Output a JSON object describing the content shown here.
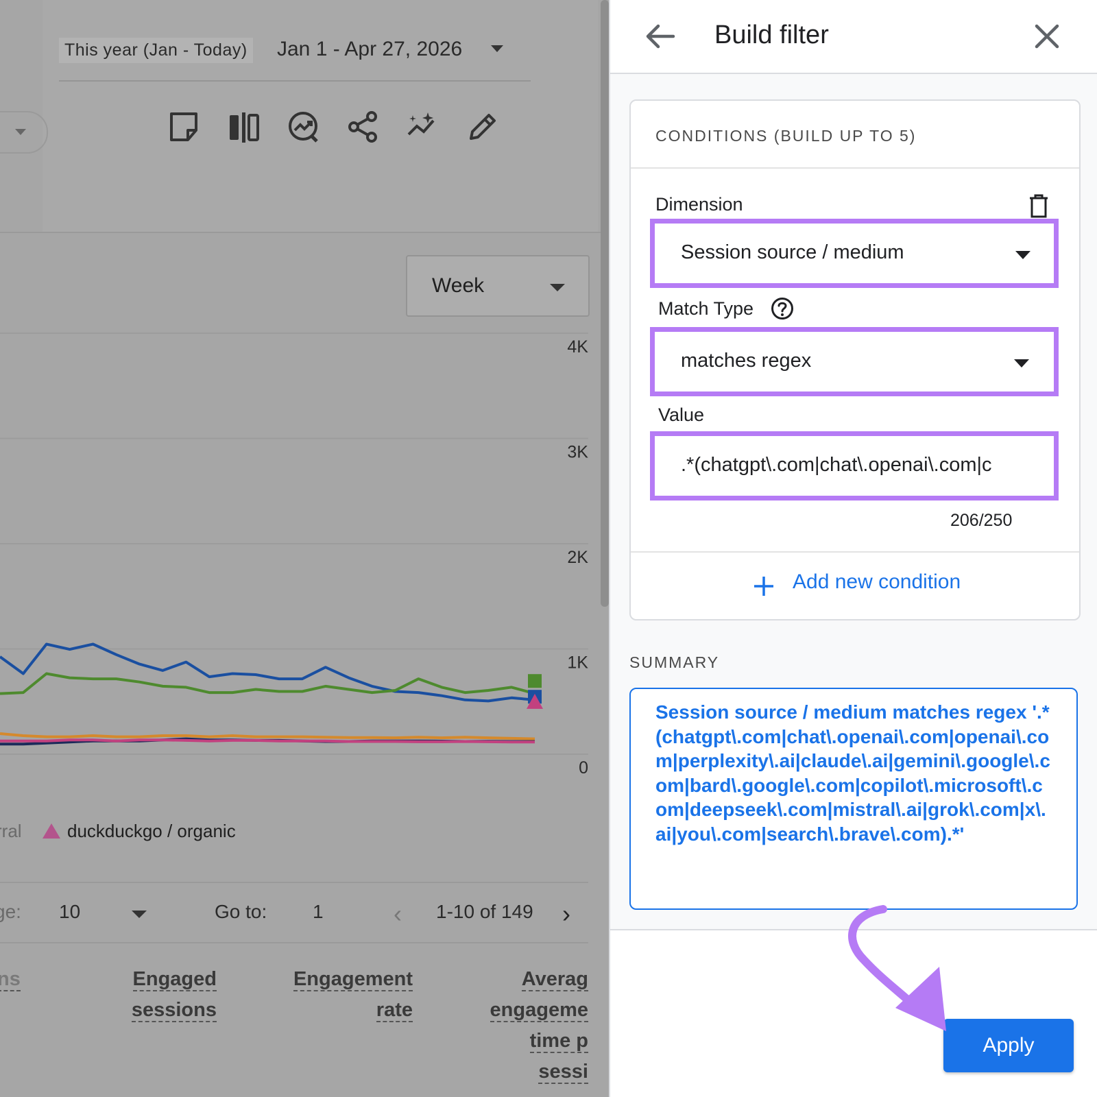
{
  "report": {
    "date_preset": "This year (Jan - Today)",
    "date_range": "Jan 1 - Apr 27, 2026",
    "granularity": "Week",
    "toolbar_icons": [
      "note-icon",
      "compare-icon",
      "insights-icon",
      "share-icon",
      "sparkle-icon",
      "edit-icon"
    ],
    "legend": {
      "fragment": "rral",
      "item": "duckduckgo / organic",
      "item_color": "#b3548c"
    },
    "pagination": {
      "rows_fragment": "ge:",
      "rows_per_page": "10",
      "goto_label": "Go to:",
      "goto_value": "1",
      "range": "1-10 of 149"
    },
    "columns": [
      {
        "lines": [
          "ns"
        ]
      },
      {
        "lines": [
          "Engaged",
          "sessions"
        ]
      },
      {
        "lines": [
          "Engagement",
          "rate"
        ]
      },
      {
        "lines": [
          "Averag",
          "engageme",
          "time p",
          "sessi"
        ]
      }
    ]
  },
  "chart_data": {
    "type": "line",
    "y_ticks": [
      "4K",
      "3K",
      "2K",
      "1K",
      "0"
    ],
    "ylim": [
      0,
      4000
    ],
    "x": [
      0,
      1,
      2,
      3,
      4,
      5,
      6,
      7,
      8,
      9,
      10,
      11,
      12,
      13,
      14,
      15,
      16,
      17,
      18,
      19,
      20,
      21,
      22,
      23
    ],
    "series": [
      {
        "color": "#1a4fa0",
        "values": [
          1030,
          870,
          1150,
          1100,
          1150,
          1050,
          960,
          900,
          980,
          840,
          870,
          860,
          820,
          820,
          930,
          830,
          750,
          700,
          690,
          660,
          620,
          610,
          640,
          620
        ]
      },
      {
        "color": "#4e8a2e",
        "values": [
          680,
          690,
          870,
          830,
          820,
          820,
          790,
          750,
          740,
          690,
          690,
          720,
          700,
          700,
          750,
          720,
          690,
          710,
          820,
          740,
          690,
          710,
          740,
          680
        ]
      },
      {
        "color": "#d5892c",
        "values": [
          300,
          280,
          270,
          270,
          280,
          270,
          270,
          280,
          280,
          270,
          280,
          270,
          270,
          270,
          265,
          262,
          262,
          260,
          265,
          260,
          265,
          260,
          255,
          250
        ]
      },
      {
        "color": "#1c2a5a",
        "values": [
          200,
          200,
          210,
          220,
          230,
          230,
          230,
          240,
          250,
          240,
          240,
          235,
          235,
          230,
          225,
          225,
          230,
          230,
          230,
          228,
          225,
          226,
          225,
          225
        ]
      },
      {
        "color": "#c2417f",
        "values": [
          230,
          230,
          230,
          240,
          240,
          230,
          240,
          240,
          235,
          230,
          235,
          235,
          230,
          230,
          230,
          225,
          225,
          225,
          222,
          222,
          225,
          222,
          220,
          220
        ]
      }
    ],
    "end_markers": [
      {
        "shape": "square",
        "color": "#4e8a2e",
        "value": 800
      },
      {
        "shape": "square",
        "color": "#1a4fa0",
        "value": 650
      },
      {
        "shape": "triangle",
        "color": "#c2417f",
        "value": 600
      }
    ]
  },
  "filter_panel": {
    "title": "Build filter",
    "conditions_title": "CONDITIONS (BUILD UP TO 5)",
    "dimension_label": "Dimension",
    "dimension_value": "Session source / medium",
    "match_type_label": "Match Type",
    "match_type_value": "matches regex",
    "value_label": "Value",
    "value_text": ".*(chatgpt\\.com|chat\\.openai\\.com|c",
    "counter": "206/250",
    "add_condition": "Add new condition",
    "summary_title": "SUMMARY",
    "summary_text": "Session source / medium matches regex '.*(chatgpt\\.com|chat\\.openai\\.com|openai\\.com|perplexity\\.ai|claude\\.ai|gemini\\.google\\.com|bard\\.google\\.com|copilot\\.microsoft\\.com|deepseek\\.com|mistral\\.ai|grok\\.com|x\\.ai|you\\.com|search\\.brave\\.com).*'",
    "apply_label": "Apply",
    "highlight_color": "#b57bf5",
    "accent_color": "#1a73e8"
  }
}
